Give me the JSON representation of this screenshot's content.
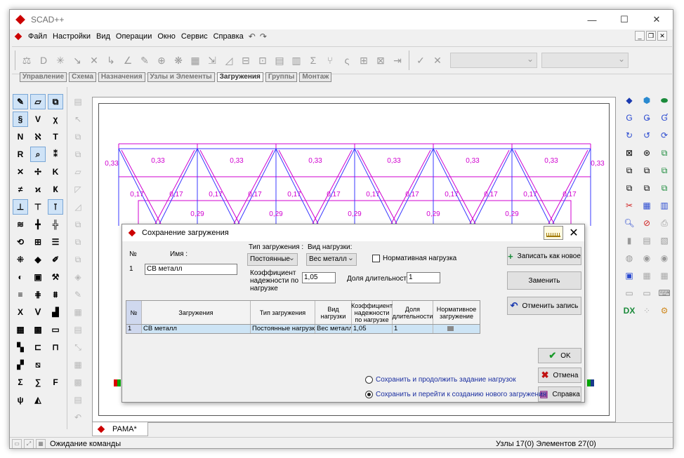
{
  "window": {
    "title": "SCAD++"
  },
  "menu": {
    "items": [
      "Файл",
      "Настройки",
      "Вид",
      "Операции",
      "Окно",
      "Сервис",
      "Справка"
    ]
  },
  "tabs": [
    "Управление",
    "Схема",
    "Назначения",
    "Узлы и Элементы",
    "Загружения",
    "Группы",
    "Монтаж"
  ],
  "active_tab": "Загружения",
  "canvas": {
    "top_values": [
      "0,33",
      "0,33",
      "0,33",
      "0,33",
      "0,33",
      "0,33",
      "0,33",
      "0,33"
    ],
    "diag_values": [
      "0,17",
      "0,17",
      "0,17",
      "0,17",
      "0,17",
      "0,17",
      "0,17",
      "0,17",
      "0,17",
      "0,17",
      "0,17",
      "0,17"
    ],
    "bottom_values": [
      "0,29",
      "0,29",
      "0,29",
      "0,29",
      "0,29"
    ],
    "load_color": "#d000d0",
    "truss_color": "#3a3aff"
  },
  "dialog": {
    "title": "Сохранение загружения",
    "num_label": "№",
    "num_value": "1",
    "name_label": "Имя :",
    "name_value": "СВ металл",
    "load_type_label": "Тип загружения :",
    "load_type_value": "Постоянные",
    "load_kind_label": "Вид нагрузки:",
    "load_kind_value": "Вес металл",
    "normative_label": "Нормативная нагрузка",
    "coef_label": "Коэффициент надежности по нагрузке",
    "coef_value": "1,05",
    "duration_label": "Доля длительности",
    "duration_value": "1",
    "btn_save_new": "Записать как новое",
    "btn_replace": "Заменить",
    "btn_cancel_record": "Отменить запись",
    "btn_ok": "OK",
    "btn_cancel": "Отмена",
    "btn_help": "Справка",
    "radio_continue": "Сохранить и продолжить задание нагрузок",
    "radio_new": "Сохранить и перейти к созданию нового загружения",
    "grid": {
      "headers": [
        "№",
        "Загружения",
        "Тип загружения",
        "Вид нагрузки",
        "Коэффициент надежности по нагрузке",
        "Доля длительности",
        "Нормативное загружение"
      ],
      "rows": [
        [
          "1",
          "СВ металл",
          "Постоянные нагрузки",
          "Вес металл",
          "1,05",
          "1",
          ""
        ]
      ]
    }
  },
  "doc_tab": "РАМА*",
  "badge": "2016",
  "status": {
    "left": "Ожидание команды",
    "right": "Узлы 17(0) Элементов 27(0)"
  }
}
